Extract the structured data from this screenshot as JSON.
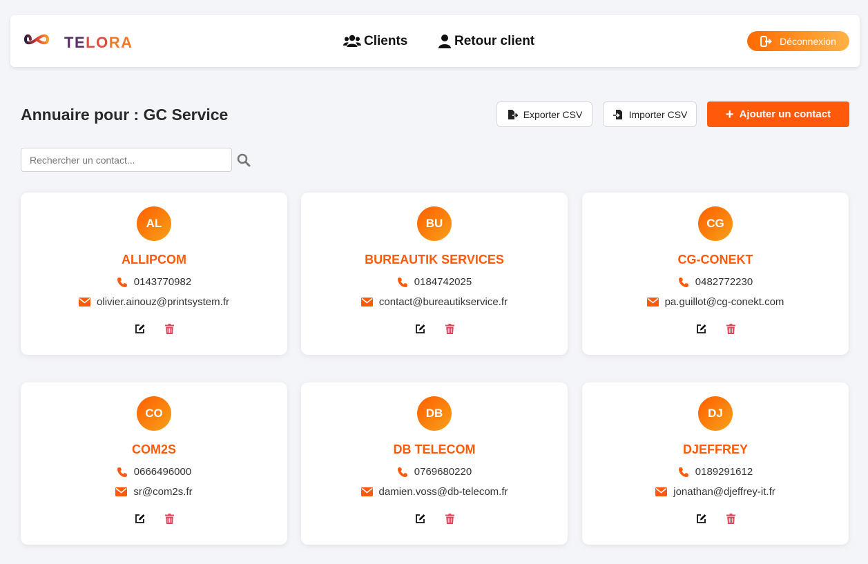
{
  "header": {
    "brand_parts": [
      "TE",
      "LO",
      "RA"
    ],
    "nav": [
      {
        "label": "Clients",
        "icon": "users-icon"
      },
      {
        "label": "Retour client",
        "icon": "user-icon"
      }
    ],
    "logout_label": "Déconnexion"
  },
  "page": {
    "title": "Annuaire pour : GC Service",
    "export_label": "Exporter CSV",
    "import_label": "Importer CSV",
    "add_label": "Ajouter un contact",
    "search_placeholder": "Rechercher un contact..."
  },
  "colors": {
    "accent": "#ff5a0a",
    "delete": "#e0455a",
    "background": "#f4f5f9"
  },
  "contacts": [
    {
      "initials": "AL",
      "name": "ALLIPCOM",
      "phone": "0143770982",
      "email": "olivier.ainouz@printsystem.fr"
    },
    {
      "initials": "BU",
      "name": "BUREAUTIK SERVICES",
      "phone": "0184742025",
      "email": "contact@bureautikservice.fr"
    },
    {
      "initials": "CG",
      "name": "CG-CONEKT",
      "phone": "0482772230",
      "email": "pa.guillot@cg-conekt.com"
    },
    {
      "initials": "CO",
      "name": "COM2S",
      "phone": "0666496000",
      "email": "sr@com2s.fr"
    },
    {
      "initials": "DB",
      "name": "DB TELECOM",
      "phone": "0769680220",
      "email": "damien.voss@db-telecom.fr"
    },
    {
      "initials": "DJ",
      "name": "DJEFFREY",
      "phone": "0189291612",
      "email": "jonathan@djeffrey-it.fr"
    }
  ]
}
